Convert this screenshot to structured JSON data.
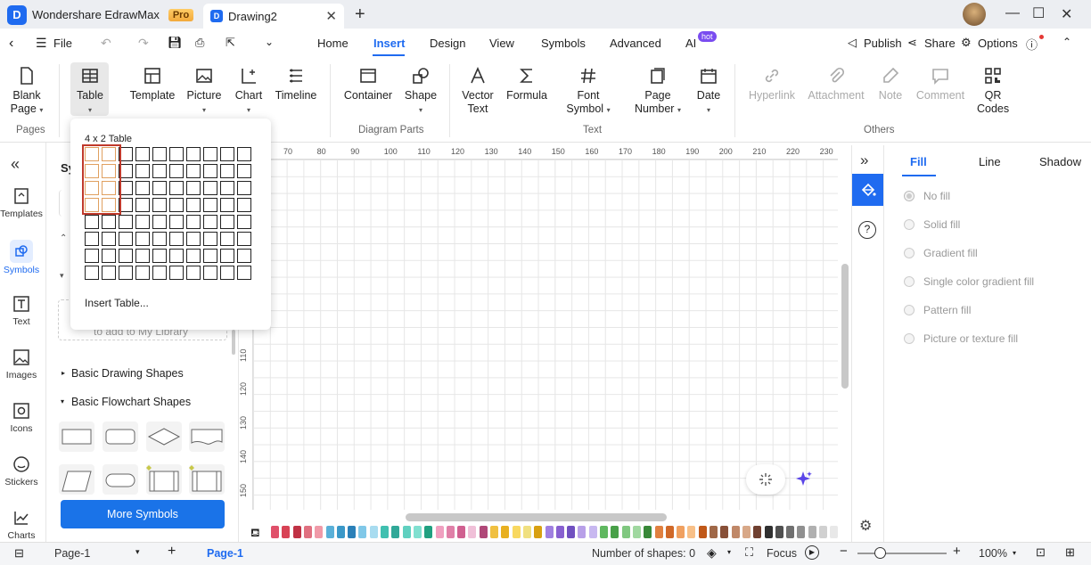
{
  "titlebar": {
    "app_name": "Wondershare EdrawMax",
    "badge": "Pro",
    "doc_tab": "Drawing2"
  },
  "menubar": {
    "file": "File",
    "tabs": [
      "Home",
      "Insert",
      "Design",
      "View",
      "Symbols",
      "Advanced",
      "AI"
    ],
    "active_tab": "Insert",
    "ai_badge": "hot",
    "publish": "Publish",
    "share": "Share",
    "options": "Options"
  },
  "ribbon": {
    "blank_page": "Blank Page",
    "table": "Table",
    "template": "Template",
    "picture": "Picture",
    "chart": "Chart",
    "timeline": "Timeline",
    "container": "Container",
    "shape": "Shape",
    "vector_text": "Vector Text",
    "formula": "Formula",
    "font_symbol": "Font Symbol",
    "page_number": "Page Number",
    "date": "Date",
    "hyperlink": "Hyperlink",
    "attachment": "Attachment",
    "note": "Note",
    "comment": "Comment",
    "qr_codes": "QR Codes",
    "groups": {
      "pages": "Pages",
      "diagram_parts": "Diagram Parts",
      "text": "Text",
      "others": "Others"
    }
  },
  "table_popup": {
    "title": "4 x 2 Table",
    "insert_table": "Insert Table...",
    "rows": 8,
    "cols": 10,
    "sel_rows": 4,
    "sel_cols": 2
  },
  "leftrail": [
    "Templates",
    "Symbols",
    "Text",
    "Images",
    "Icons",
    "Stickers",
    "Charts"
  ],
  "sympanel": {
    "title": "Sy",
    "library_hint": "to add to My Library",
    "categories": [
      "Basic Drawing Shapes",
      "Basic Flowchart Shapes"
    ],
    "more_symbols": "More Symbols"
  },
  "ruler": {
    "h": [
      "70",
      "80",
      "90",
      "100",
      "110",
      "120",
      "130",
      "140",
      "150",
      "160",
      "170",
      "180",
      "190",
      "200",
      "210",
      "220",
      "230"
    ],
    "v": [
      "110",
      "120",
      "130",
      "140",
      "150"
    ]
  },
  "right_panel": {
    "tabs": [
      "Fill",
      "Line",
      "Shadow"
    ],
    "active_tab": "Fill",
    "options": [
      "No fill",
      "Solid fill",
      "Gradient fill",
      "Single color gradient fill",
      "Pattern fill",
      "Picture or texture fill"
    ]
  },
  "statusbar": {
    "page_select": "Page-1",
    "page_tab": "Page-1",
    "shapes": "Number of shapes: 0",
    "focus": "Focus",
    "zoom": "100%"
  },
  "colors": {
    "accent": "#1f6bf0",
    "button": "#1a73e8"
  }
}
